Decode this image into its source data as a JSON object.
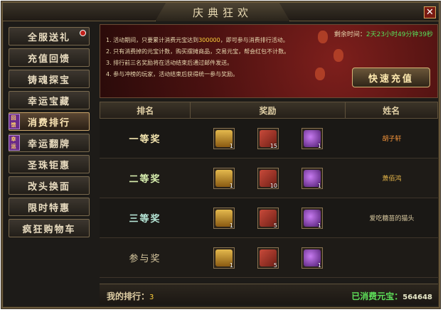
{
  "window": {
    "title": "庆典狂欢",
    "close": "✕"
  },
  "sidebar": {
    "items": [
      {
        "label": "全服送礼",
        "badge": true
      },
      {
        "label": "充值回馈"
      },
      {
        "label": "铸魂探宝"
      },
      {
        "label": "幸运宝藏"
      },
      {
        "label": "消费排行",
        "tag": "回馈",
        "active": true
      },
      {
        "label": "幸运翻牌",
        "tag": "幸运"
      },
      {
        "label": "圣珠钜惠"
      },
      {
        "label": "改头换面"
      },
      {
        "label": "限时特惠"
      },
      {
        "label": "疯狂购物车"
      }
    ]
  },
  "banner": {
    "rules": [
      {
        "pre": "1. 活动期间，只要累计消费元宝达到",
        "hl": "300000",
        "post": "，即可参与消费排行活动。"
      },
      {
        "pre": "2. 只有消费掉的元宝计数，购买摆摊商品，交易元宝，帮会红包不计数。",
        "hl": "",
        "post": ""
      },
      {
        "pre": "3. 排行前三名奖励将在活动结束后通过邮件发送。",
        "hl": "",
        "post": ""
      },
      {
        "pre": "4. 参与冲榜的玩家，活动结束后获得统一参与奖励。",
        "hl": "",
        "post": ""
      }
    ],
    "countdown_label": "剩余时间：",
    "countdown_value": "2天23小时49分钟39秒",
    "charge_label": "快速充值"
  },
  "table": {
    "headers": [
      "排名",
      "奖励",
      "姓名"
    ],
    "rows": [
      {
        "rank": "一等奖",
        "items": [
          {
            "icon": "gold-chest-icon",
            "qty": "1"
          },
          {
            "icon": "scroll-icon",
            "qty": "15"
          },
          {
            "icon": "purple-bag-icon",
            "qty": "1"
          }
        ],
        "name": "胡子轩",
        "name_color": "orange"
      },
      {
        "rank": "二等奖",
        "items": [
          {
            "icon": "gold-chest-icon",
            "qty": "1"
          },
          {
            "icon": "scroll-icon",
            "qty": "10"
          },
          {
            "icon": "purple-bag-icon",
            "qty": "1"
          }
        ],
        "name": "萧佰鸿",
        "name_color": "yellow"
      },
      {
        "rank": "三等奖",
        "items": [
          {
            "icon": "gold-chest-icon",
            "qty": "1"
          },
          {
            "icon": "scroll-icon",
            "qty": "5"
          },
          {
            "icon": "purple-bag-icon",
            "qty": "1"
          }
        ],
        "name": "爱吃糖苗的猫头",
        "name_color": "plain"
      },
      {
        "rank": "参与奖",
        "items": [
          {
            "icon": "gold-chest-icon",
            "qty": "1"
          },
          {
            "icon": "scroll-icon",
            "qty": "5"
          },
          {
            "icon": "purple-bag-icon",
            "qty": "1"
          }
        ],
        "name": "",
        "name_color": "plain"
      }
    ]
  },
  "footer": {
    "my_rank_label": "我的排行：",
    "my_rank_value": "3",
    "spent_label": "已消费元宝：",
    "spent_value": "564648"
  }
}
